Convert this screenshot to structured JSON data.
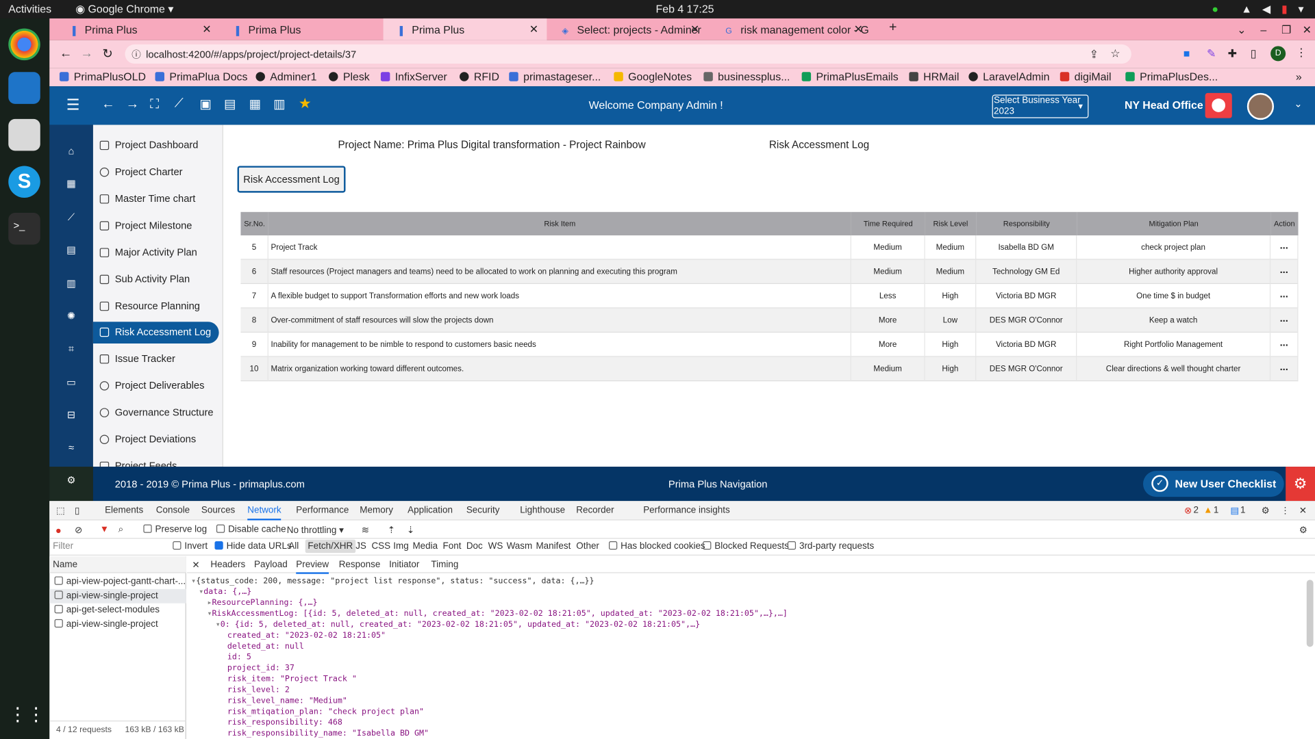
{
  "os": {
    "activities": "Activities",
    "app_name": "Google Chrome",
    "datetime": "Feb 4  17:25"
  },
  "browser": {
    "tabs": [
      {
        "label": "Prima Plus"
      },
      {
        "label": "Prima Plus"
      },
      {
        "label": "Prima Plus"
      },
      {
        "label": "Select: projects - Adminer"
      },
      {
        "label": "risk management color - G"
      }
    ],
    "url": "localhost:4200/#/apps/project/project-details/37",
    "profile_initial": "D",
    "bookmarks": [
      "PrimaPlusOLD",
      "PrimaPlua Docs",
      "Adminer1",
      "Plesk",
      "InfixServer",
      "RFID",
      "primastageser...",
      "GoogleNotes",
      "businessplus...",
      "PrimaPlusEmails",
      "HRMail",
      "LaravelAdmin",
      "digiMail",
      "PrimaPlusDes..."
    ]
  },
  "header": {
    "welcome": "Welcome  Company Admin !",
    "business_year_label": "Select Business Year",
    "business_year_value": "2023",
    "office": "NY Head Office"
  },
  "sidenav": [
    "Project Dashboard",
    "Project Charter",
    "Master Time chart",
    "Project Milestone",
    "Major Activity Plan",
    "Sub Activity Plan",
    "Resource Planning",
    "Risk Accessment Log",
    "Issue Tracker",
    "Project Deliverables",
    "Governance Structure",
    "Project Deviations",
    "Project Feeds"
  ],
  "main": {
    "project_name": "Project Name: Prima Plus Digital transformation - Project Rainbow",
    "section_title": "Risk Accessment Log",
    "button": "Risk Accessment Log",
    "columns": [
      "Sr.No.",
      "Risk Item",
      "Time Required",
      "Risk Level",
      "Responsibility",
      "Mitigation Plan",
      "Action"
    ],
    "rows": [
      {
        "sr": "5",
        "item": "Project Track",
        "time": "Medium",
        "level": "Medium",
        "resp": "Isabella BD GM",
        "plan": "check project plan",
        "action": "..."
      },
      {
        "sr": "6",
        "item": "Staff resources (Project managers and teams) need to be allocated to work on planning and executing this program",
        "time": "Medium",
        "level": "Medium",
        "resp": "Technology GM Ed",
        "plan": "Higher authority approval",
        "action": "..."
      },
      {
        "sr": "7",
        "item": "A flexible budget to support Transformation efforts and new work loads",
        "time": "Less",
        "level": "High",
        "resp": "Victoria BD MGR",
        "plan": "One time $ in budget",
        "action": "..."
      },
      {
        "sr": "8",
        "item": "Over-commitment of staff resources will slow the projects down",
        "time": "More",
        "level": "Low",
        "resp": "DES MGR O'Connor",
        "plan": "Keep a watch",
        "action": "..."
      },
      {
        "sr": "9",
        "item": "Inability for management to be nimble to respond to customers basic needs",
        "time": "More",
        "level": "High",
        "resp": "Victoria BD MGR",
        "plan": "Right Portfolio Management",
        "action": "..."
      },
      {
        "sr": "10",
        "item": "Matrix organization working toward different outcomes.",
        "time": "Medium",
        "level": "High",
        "resp": "DES MGR O'Connor",
        "plan": "Clear directions & well thought charter",
        "action": "..."
      }
    ]
  },
  "footer": {
    "copyright": "2018 - 2019 © Prima Plus - primaplus.com",
    "nav": "Prima Plus Navigation",
    "checklist": "New User Checklist"
  },
  "devtools": {
    "tabs": [
      "Elements",
      "Console",
      "Sources",
      "Network",
      "Performance",
      "Memory",
      "Application",
      "Security",
      "Lighthouse",
      "Recorder",
      "Performance insights"
    ],
    "errors": "2",
    "warnings": "1",
    "messages": "1",
    "preserve_log": "Preserve log",
    "disable_cache": "Disable cache",
    "throttling": "No throttling",
    "filter_placeholder": "Filter",
    "filter_opts": [
      "Invert",
      "Hide data URLs",
      "All",
      "Fetch/XHR",
      "JS",
      "CSS",
      "Img",
      "Media",
      "Font",
      "Doc",
      "WS",
      "Wasm",
      "Manifest",
      "Other",
      "Has blocked cookies",
      "Blocked Requests",
      "3rd-party requests"
    ],
    "name_header": "Name",
    "requests": [
      "api-view-poject-gantt-chart-...",
      "api-view-single-project",
      "api-get-select-modules",
      "api-view-single-project"
    ],
    "status": "4 / 12 requests",
    "size": "163 kB / 163 kB",
    "detail_tabs": [
      "Headers",
      "Payload",
      "Preview",
      "Response",
      "Initiator",
      "Timing"
    ],
    "preview_lines": [
      "{status_code: 200, message: \"project list response\", status: \"success\", data: {,…}}",
      "data: {,…}",
      "ResourcePlanning: {,…}",
      "RiskAccessmentLog: [{id: 5, deleted_at: null, created_at: \"2023-02-02 18:21:05\", updated_at: \"2023-02-02 18:21:05\",…},…]",
      "0: {id: 5, deleted_at: null, created_at: \"2023-02-02 18:21:05\", updated_at: \"2023-02-02 18:21:05\",…}",
      "created_at: \"2023-02-02 18:21:05\"",
      "deleted_at: null",
      "id: 5",
      "project_id: 37",
      "risk_item: \"Project Track \"",
      "risk_level: 2",
      "risk_level_name: \"Medium\"",
      "risk_mtiqation_plan: \"check project plan\"",
      "risk_responsibility: 468",
      "risk_responsibility_name: \"Isabella BD GM\""
    ]
  },
  "colors": {
    "header_blue": "#0d5a9c",
    "footer_navy": "#053566",
    "tab_pink": "#f7a9bd",
    "checklist_red": "#e53935"
  }
}
